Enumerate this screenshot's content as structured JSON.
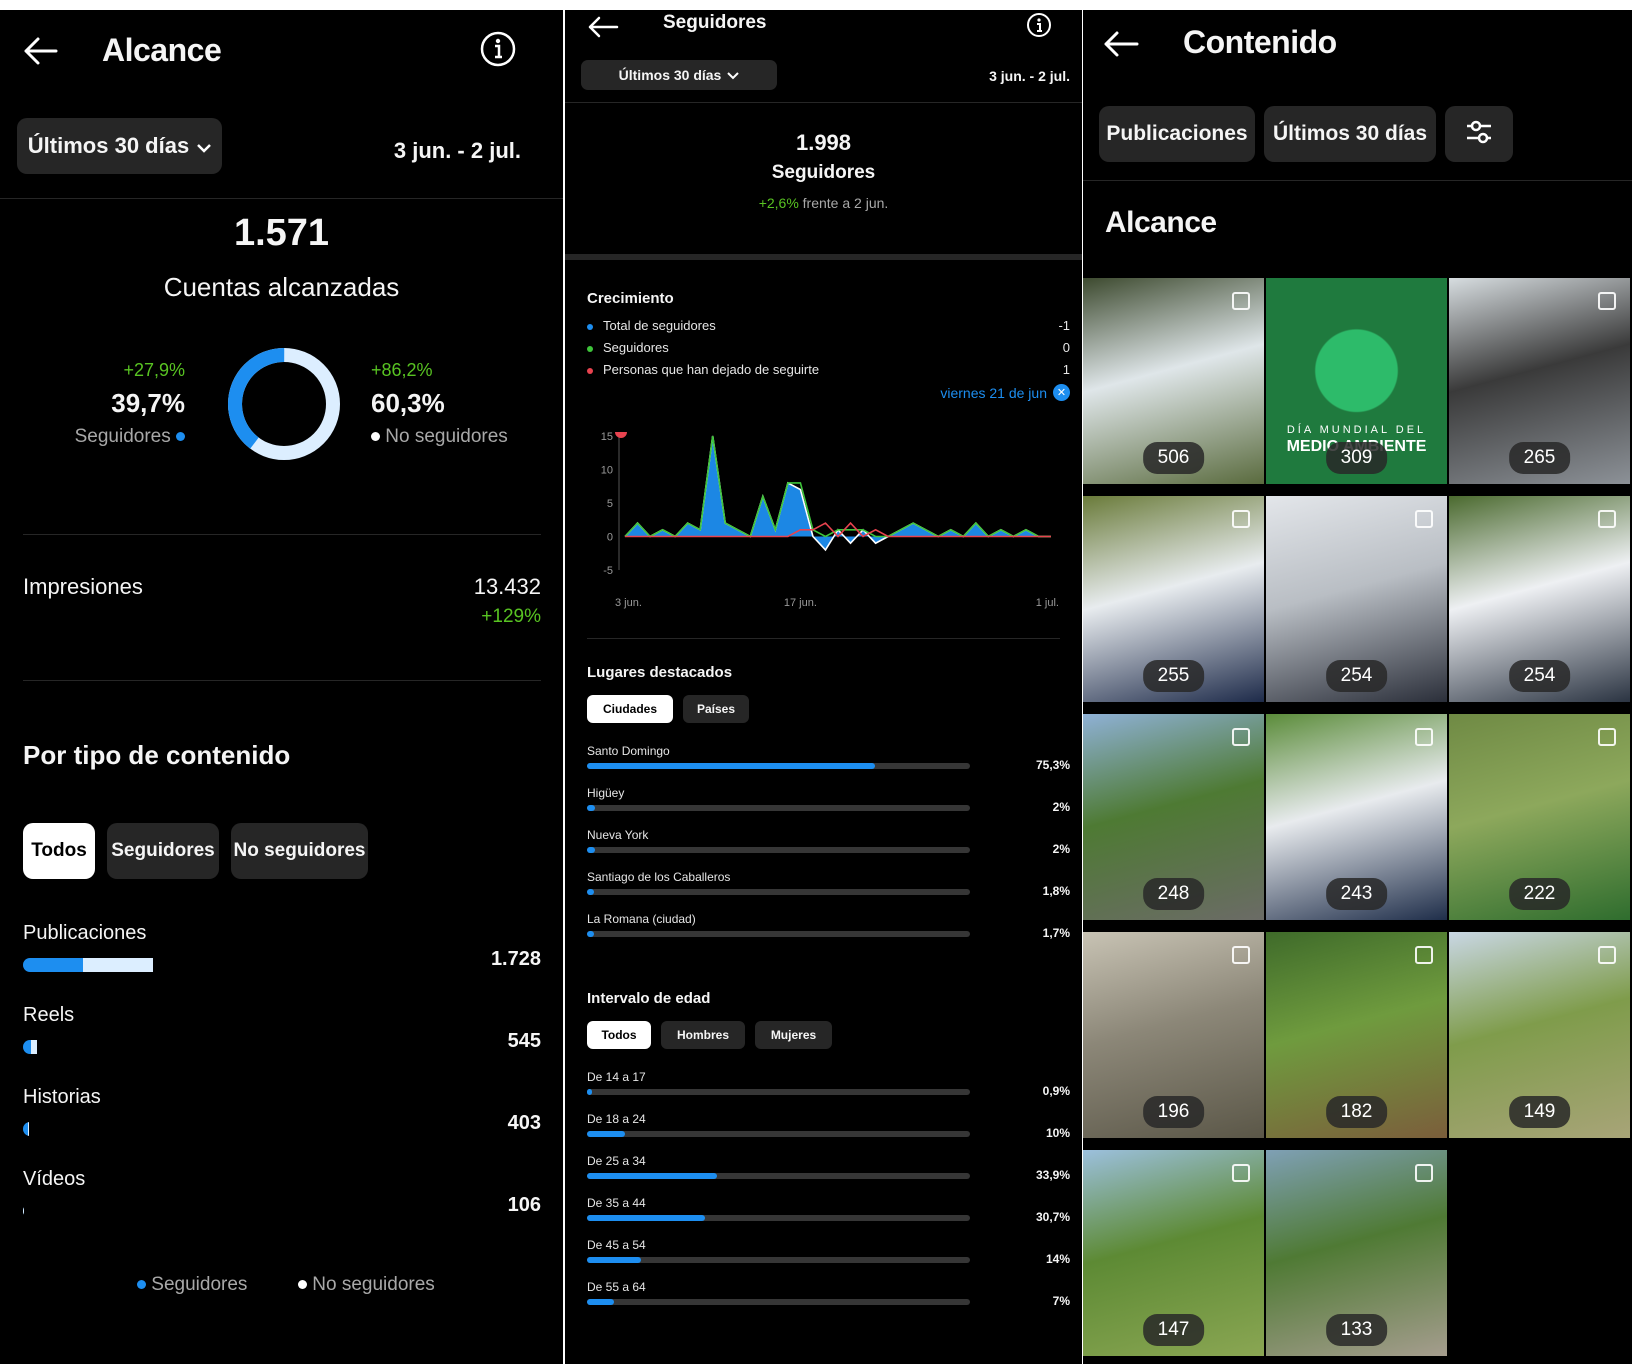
{
  "reach": {
    "title": "Alcance",
    "period": "Últimos 30 días",
    "date_range": "3 jun. - 2 jul.",
    "accounts_reached": "1.571",
    "accounts_reached_label": "Cuentas alcanzadas",
    "followers_change": "+27,9%",
    "followers_pct": "39,7%",
    "followers_label": "Seguidores",
    "nonfollowers_change": "+86,2%",
    "nonfollowers_pct": "60,3%",
    "nonfollowers_label": "No seguidores",
    "donut_followers_fraction": 0.397,
    "impressions_label": "Impresiones",
    "impressions_value": "13.432",
    "impressions_change": "+129%",
    "content_type_title": "Por tipo de contenido",
    "filters": [
      "Todos",
      "Seguidores",
      "No seguidores"
    ],
    "content_types": [
      {
        "label": "Publicaciones",
        "value": "1.728",
        "followers": 0.23,
        "nonfollowers": 0.27
      },
      {
        "label": "Reels",
        "value": "545",
        "followers": 0.09,
        "nonfollowers": 0.075
      },
      {
        "label": "Historias",
        "value": "403",
        "followers": 0.09,
        "nonfollowers": 0.02
      },
      {
        "label": "Vídeos",
        "value": "106",
        "followers": 0.02,
        "nonfollowers": 0.015
      }
    ],
    "legend_followers": "Seguidores",
    "legend_nonfollowers": "No seguidores"
  },
  "followers": {
    "title": "Seguidores",
    "period": "Últimos 30 días",
    "date_range": "3 jun. - 2 jul.",
    "count": "1.998",
    "count_label": "Seguidores",
    "change": "+2,6%",
    "change_suffix": "frente a 2 jun.",
    "growth_title": "Crecimiento",
    "growth_rows": [
      {
        "label": "Total de seguidores",
        "value": "-1",
        "color": "#1d8ef0"
      },
      {
        "label": "Seguidores",
        "value": "0",
        "color": "#3ec43a"
      },
      {
        "label": "Personas que han dejado de seguirte",
        "value": "1",
        "color": "#e8434f"
      }
    ],
    "selected_date": "viernes 21 de jun",
    "places_title": "Lugares destacados",
    "places_tabs": [
      "Ciudades",
      "Países"
    ],
    "places": [
      {
        "label": "Santo Domingo",
        "pct": "75,3%",
        "frac": 0.753
      },
      {
        "label": "Higüey",
        "pct": "2%",
        "frac": 0.02
      },
      {
        "label": "Nueva York",
        "pct": "2%",
        "frac": 0.02
      },
      {
        "label": "Santiago de los Caballeros",
        "pct": "1,8%",
        "frac": 0.018
      },
      {
        "label": "La Romana (ciudad)",
        "pct": "1,7%",
        "frac": 0.017
      }
    ],
    "age_title": "Intervalo de edad",
    "age_tabs": [
      "Todos",
      "Hombres",
      "Mujeres"
    ],
    "ages": [
      {
        "label": "De 14 a 17",
        "pct": "0,9%",
        "frac": 0.009
      },
      {
        "label": "De 18 a 24",
        "pct": "10%",
        "frac": 0.1
      },
      {
        "label": "De 25 a 34",
        "pct": "33,9%",
        "frac": 0.339
      },
      {
        "label": "De 35 a 44",
        "pct": "30,7%",
        "frac": 0.307
      },
      {
        "label": "De 45 a 54",
        "pct": "14%",
        "frac": 0.14
      },
      {
        "label": "De 55 a 64",
        "pct": "7%",
        "frac": 0.07
      }
    ]
  },
  "chart_data": {
    "type": "area",
    "x_ticks": [
      "3 jun.",
      "17 jun.",
      "1 jul."
    ],
    "y_ticks": [
      "15",
      "10",
      "5",
      "0",
      "-5"
    ],
    "ylim": [
      -5,
      15
    ],
    "series": [
      {
        "name": "Total de seguidores",
        "color": "#1d8ef0",
        "values": [
          0,
          2,
          0,
          1,
          0,
          2,
          1,
          15,
          2,
          1,
          0,
          6,
          1,
          8,
          7,
          0,
          -2,
          1,
          -1,
          1,
          -1,
          0,
          1,
          2,
          1,
          0,
          1,
          0,
          2,
          0,
          1,
          0,
          1,
          0,
          0
        ]
      },
      {
        "name": "Seguidores",
        "color": "#3ec43a",
        "values": [
          0,
          2,
          0,
          1,
          0,
          2,
          1,
          15,
          2,
          1,
          0,
          6,
          1,
          8,
          8,
          1,
          0,
          1,
          1,
          1,
          0,
          0,
          1,
          2,
          1,
          0,
          1,
          0,
          2,
          0,
          1,
          0,
          1,
          0,
          0
        ]
      },
      {
        "name": "Personas que han dejado de seguirte",
        "color": "#e8434f",
        "values": [
          0,
          0,
          0,
          0,
          0,
          0,
          0,
          0,
          0,
          0,
          0,
          0,
          0,
          0,
          1,
          1,
          2,
          0,
          2,
          0,
          1,
          0,
          0,
          0,
          0,
          0,
          0,
          0,
          0,
          0,
          0,
          0,
          0,
          0,
          0
        ]
      }
    ]
  },
  "content": {
    "title": "Contenido",
    "chip_posts": "Publicaciones",
    "chip_period": "Últimos 30 días",
    "section_title": "Alcance",
    "posts": [
      {
        "value": "506",
        "colors": [
          "#3d4a2f",
          "#dfe6e9",
          "#5a6b3e"
        ]
      },
      {
        "value": "309",
        "colors": [
          "#1f7a3e",
          "#2f9b4f",
          "#2dbb6a"
        ],
        "caption": "DÍA MUNDIAL DEL",
        "caption2": "MEDIO AMBIENTE"
      },
      {
        "value": "265",
        "colors": [
          "#d7dde0",
          "#3a3a3a",
          "#8c9197"
        ]
      },
      {
        "value": "255",
        "colors": [
          "#6a7b3a",
          "#e8ecef",
          "#1e2b4a"
        ]
      },
      {
        "value": "254",
        "colors": [
          "#e3e6ea",
          "#b9bec4",
          "#2b2f3a"
        ]
      },
      {
        "value": "254",
        "colors": [
          "#4b6a2f",
          "#eef0f3",
          "#2b3442"
        ]
      },
      {
        "value": "248",
        "colors": [
          "#8fb1d6",
          "#4e7a33",
          "#6b6b66"
        ]
      },
      {
        "value": "243",
        "colors": [
          "#5b8c3a",
          "#e8ebee",
          "#1f2e4a"
        ]
      },
      {
        "value": "222",
        "colors": [
          "#6f8a44",
          "#8da85c",
          "#2f6d2e"
        ]
      },
      {
        "value": "196",
        "colors": [
          "#c8c3b4",
          "#8c8778",
          "#5b5748"
        ]
      },
      {
        "value": "182",
        "colors": [
          "#3f6b2a",
          "#6f9b3e",
          "#7b5e3b"
        ]
      },
      {
        "value": "149",
        "colors": [
          "#c9d7e4",
          "#7f9c4b",
          "#a8a478"
        ]
      },
      {
        "value": "147",
        "colors": [
          "#9cc0dd",
          "#5d8a34",
          "#8aa653"
        ]
      },
      {
        "value": "133",
        "colors": [
          "#7fa0b5",
          "#4f7a34",
          "#a59d8e"
        ]
      }
    ]
  }
}
